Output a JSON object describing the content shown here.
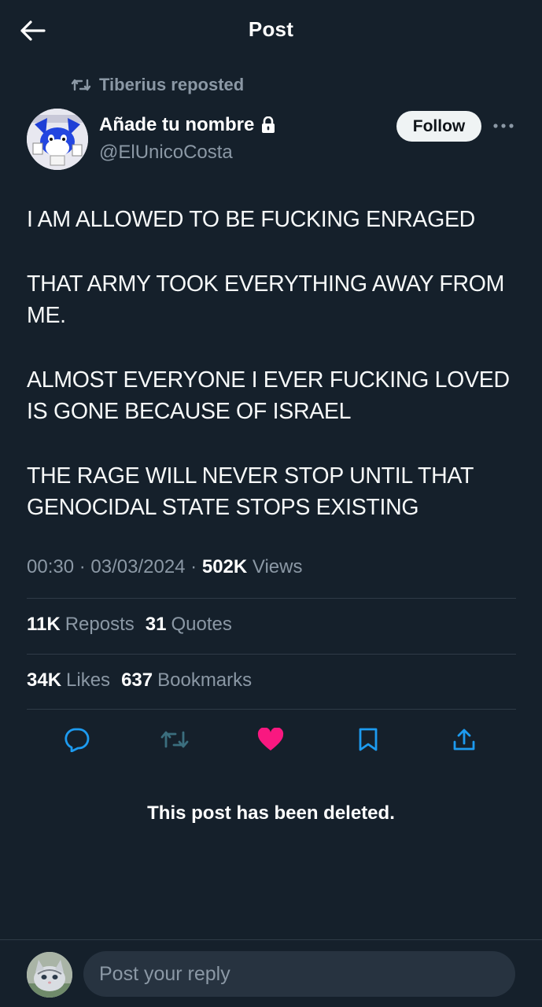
{
  "header": {
    "title": "Post"
  },
  "repost": {
    "text": "Tiberius reposted"
  },
  "author": {
    "name": "Añade tu nombre",
    "handle": "@ElUnicoCosta",
    "follow_label": "Follow"
  },
  "post": {
    "paragraphs": [
      "I AM ALLOWED TO BE FUCKING ENRAGED",
      "THAT ARMY TOOK EVERYTHING AWAY FROM ME.",
      "ALMOST EVERYONE I EVER FUCKING LOVED IS GONE BECAUSE OF ISRAEL",
      "THE RAGE WILL NEVER STOP UNTIL THAT GENOCIDAL STATE STOPS EXISTING"
    ],
    "time": "00:30",
    "date": "03/03/2024",
    "views_count": "502K",
    "views_label": "Views"
  },
  "stats": {
    "reposts_count": "11K",
    "reposts_label": "Reposts",
    "quotes_count": "31",
    "quotes_label": "Quotes",
    "likes_count": "34K",
    "likes_label": "Likes",
    "bookmarks_count": "637",
    "bookmarks_label": "Bookmarks"
  },
  "notice": {
    "deleted": "This post has been deleted."
  },
  "reply": {
    "placeholder": "Post your reply"
  },
  "colors": {
    "background": "#15202b",
    "secondary_text": "#8b98a5",
    "like_active": "#f91880"
  }
}
